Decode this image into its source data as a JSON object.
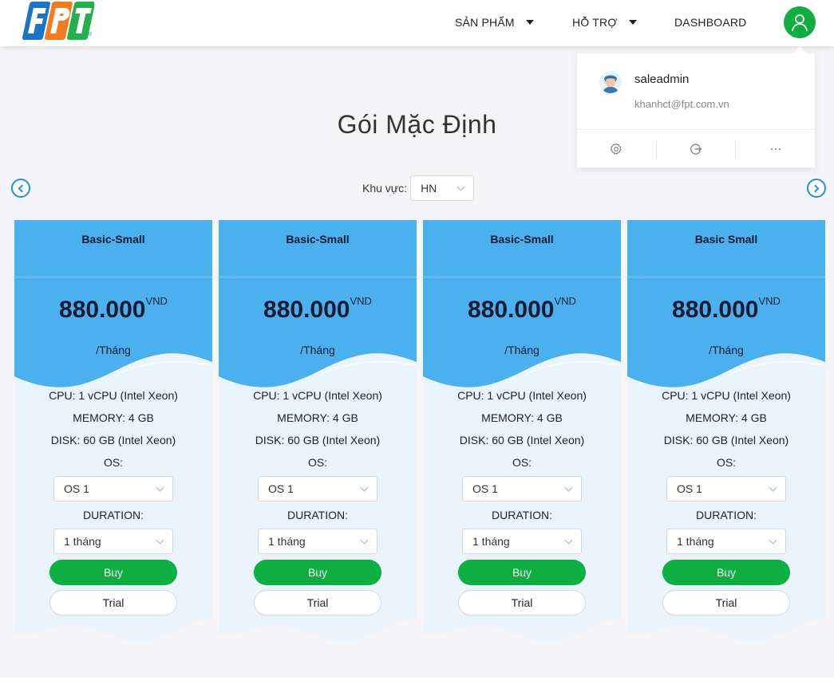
{
  "header": {
    "logo_text": "FPT",
    "nav": [
      {
        "label": "SẢN PHẨM",
        "has_caret": true
      },
      {
        "label": "HỖ TRỢ",
        "has_caret": true
      },
      {
        "label": "DASHBOARD",
        "has_caret": false
      }
    ]
  },
  "user_menu": {
    "username": "saleadmin",
    "email": "khanhct@fpt.com.vn",
    "actions": [
      "gear-icon",
      "logout-icon",
      "more-icon"
    ]
  },
  "page": {
    "title": "Gói Mặc Định",
    "region_label": "Khu vực:",
    "region_value": "HN"
  },
  "colors": {
    "brand_green": "#0fae41",
    "card_blue": "#4bb0ee",
    "card_light": "#eaf4fd",
    "arrow_blue": "#1e90e8"
  },
  "plans": [
    {
      "name": "Basic-Small",
      "price": "880.000",
      "currency": "VND",
      "period": "/Tháng",
      "cpu": "CPU: 1 vCPU (Intel Xeon)",
      "memory": "MEMORY: 4 GB",
      "disk": "DISK: 60 GB (Intel Xeon)",
      "os_label": "OS:",
      "os_value": "OS 1",
      "duration_label": "DURATION:",
      "duration_value": "1 tháng",
      "buy_label": "Buy",
      "trial_label": "Trial"
    },
    {
      "name": "Basic-Small",
      "price": "880.000",
      "currency": "VND",
      "period": "/Tháng",
      "cpu": "CPU: 1 vCPU (Intel Xeon)",
      "memory": "MEMORY: 4 GB",
      "disk": "DISK: 60 GB (Intel Xeon)",
      "os_label": "OS:",
      "os_value": "OS 1",
      "duration_label": "DURATION:",
      "duration_value": "1 tháng",
      "buy_label": "Buy",
      "trial_label": "Trial"
    },
    {
      "name": "Basic-Small",
      "price": "880.000",
      "currency": "VND",
      "period": "/Tháng",
      "cpu": "CPU: 1 vCPU (Intel Xeon)",
      "memory": "MEMORY: 4 GB",
      "disk": "DISK: 60 GB (Intel Xeon)",
      "os_label": "OS:",
      "os_value": "OS 1",
      "duration_label": "DURATION:",
      "duration_value": "1 tháng",
      "buy_label": "Buy",
      "trial_label": "Trial"
    },
    {
      "name": "Basic Small",
      "price": "880.000",
      "currency": "VND",
      "period": "/Tháng",
      "cpu": "CPU: 1 vCPU (Intel Xeon)",
      "memory": "MEMORY: 4 GB",
      "disk": "DISK: 60 GB (Intel Xeon)",
      "os_label": "OS:",
      "os_value": "OS 1",
      "duration_label": "DURATION:",
      "duration_value": "1 tháng",
      "buy_label": "Buy",
      "trial_label": "Trial"
    }
  ]
}
